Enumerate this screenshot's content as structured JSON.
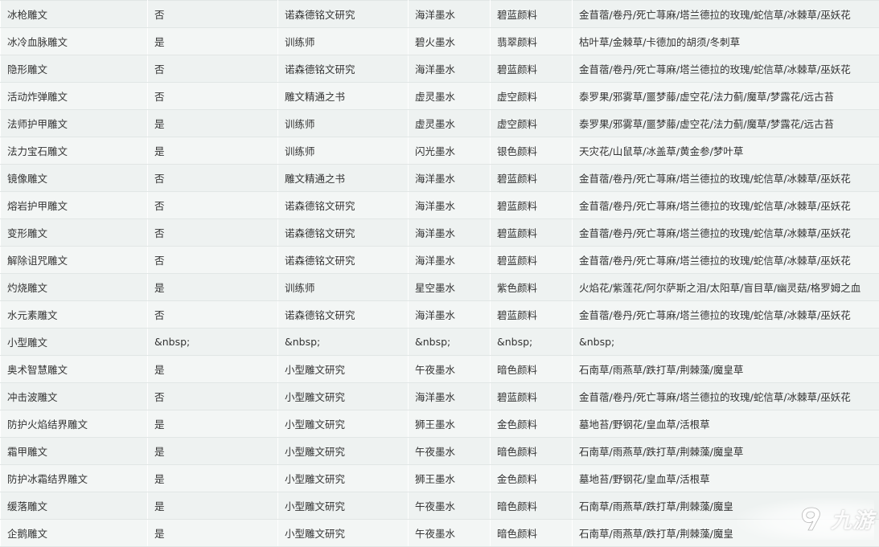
{
  "rows": [
    [
      "冰枪雕文",
      "否",
      "诺森德铭文研究",
      "海洋墨水",
      "碧蓝颜料",
      "金苜蓿/卷丹/死亡荨麻/塔兰德拉的玫瑰/蛇信草/冰棘草/巫妖花"
    ],
    [
      "冰冷血脉雕文",
      "是",
      "训练师",
      "碧火墨水",
      "翡翠颜料",
      "枯叶草/金棘草/卡德加的胡须/冬刺草"
    ],
    [
      "隐形雕文",
      "否",
      "诺森德铭文研究",
      "海洋墨水",
      "碧蓝颜料",
      "金苜蓿/卷丹/死亡荨麻/塔兰德拉的玫瑰/蛇信草/冰棘草/巫妖花"
    ],
    [
      "活动炸弹雕文",
      "否",
      "雕文精通之书",
      "虚灵墨水",
      "虚空颜料",
      "泰罗果/邪雾草/噩梦藤/虚空花/法力蓟/魔草/梦露花/远古苔"
    ],
    [
      "法师护甲雕文",
      "是",
      "训练师",
      "虚灵墨水",
      "虚空颜料",
      "泰罗果/邪雾草/噩梦藤/虚空花/法力蓟/魔草/梦露花/远古苔"
    ],
    [
      "法力宝石雕文",
      "是",
      "训练师",
      "闪光墨水",
      "银色颜料",
      "天灾花/山鼠草/冰盖草/黄金参/梦叶草"
    ],
    [
      "镜像雕文",
      "否",
      "雕文精通之书",
      "海洋墨水",
      "碧蓝颜料",
      "金苜蓿/卷丹/死亡荨麻/塔兰德拉的玫瑰/蛇信草/冰棘草/巫妖花"
    ],
    [
      "熔岩护甲雕文",
      "否",
      "诺森德铭文研究",
      "海洋墨水",
      "碧蓝颜料",
      "金苜蓿/卷丹/死亡荨麻/塔兰德拉的玫瑰/蛇信草/冰棘草/巫妖花"
    ],
    [
      "变形雕文",
      "否",
      "诺森德铭文研究",
      "海洋墨水",
      "碧蓝颜料",
      "金苜蓿/卷丹/死亡荨麻/塔兰德拉的玫瑰/蛇信草/冰棘草/巫妖花"
    ],
    [
      "解除诅咒雕文",
      "否",
      "诺森德铭文研究",
      "海洋墨水",
      "碧蓝颜料",
      "金苜蓿/卷丹/死亡荨麻/塔兰德拉的玫瑰/蛇信草/冰棘草/巫妖花"
    ],
    [
      "灼烧雕文",
      "是",
      "训练师",
      "星空墨水",
      "紫色颜料",
      "火焰花/紫莲花/阿尔萨斯之泪/太阳草/盲目草/幽灵菇/格罗姆之血"
    ],
    [
      "水元素雕文",
      "否",
      "诺森德铭文研究",
      "海洋墨水",
      "碧蓝颜料",
      "金苜蓿/卷丹/死亡荨麻/塔兰德拉的玫瑰/蛇信草/冰棘草/巫妖花"
    ],
    [
      "小型雕文",
      "&nbsp;",
      "&nbsp;",
      "&nbsp;",
      "&nbsp;",
      "&nbsp;"
    ],
    [
      "奥术智慧雕文",
      "是",
      "小型雕文研究",
      "午夜墨水",
      "暗色颜料",
      "石南草/雨燕草/跌打草/荆棘藻/魔皇草"
    ],
    [
      "冲击波雕文",
      "否",
      "小型雕文研究",
      "海洋墨水",
      "碧蓝颜料",
      "金苜蓿/卷丹/死亡荨麻/塔兰德拉的玫瑰/蛇信草/冰棘草/巫妖花"
    ],
    [
      "防护火焰结界雕文",
      "是",
      "小型雕文研究",
      "狮王墨水",
      "金色颜料",
      "墓地苔/野钢花/皇血草/活根草"
    ],
    [
      "霜甲雕文",
      "是",
      "小型雕文研究",
      "午夜墨水",
      "暗色颜料",
      "石南草/雨燕草/跌打草/荆棘藻/魔皇草"
    ],
    [
      "防护冰霜结界雕文",
      "是",
      "小型雕文研究",
      "狮王墨水",
      "金色颜料",
      "墓地苔/野钢花/皇血草/活根草"
    ],
    [
      "缓落雕文",
      "是",
      "小型雕文研究",
      "午夜墨水",
      "暗色颜料",
      "石南草/雨燕草/跌打草/荆棘藻/魔皇"
    ],
    [
      "企鹅雕文",
      "是",
      "小型雕文研究",
      "午夜墨水",
      "暗色颜料",
      "石南草/雨燕草/跌打草/荆棘藻/魔皇"
    ]
  ],
  "watermark": {
    "logo": "9you-logo-icon",
    "text": "九游"
  },
  "colors": {
    "background": "#eef2f1",
    "text": "#333333",
    "border": "#ffffff"
  }
}
